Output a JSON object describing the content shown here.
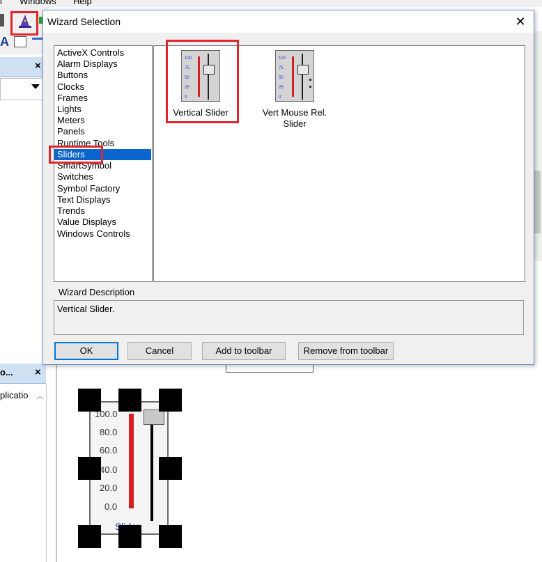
{
  "menubar": {
    "items": [
      "l",
      "Windows",
      "Help"
    ]
  },
  "background_panels": {
    "panel1_close": "×",
    "panel2_title": "o...",
    "panel2_close": "×",
    "panel2_item": "plicatio"
  },
  "wizard": {
    "title": "Wizard Selection",
    "close_glyph": "✕",
    "categories": [
      "ActiveX Controls",
      "Alarm Displays",
      "Buttons",
      "Clocks",
      "Frames",
      "Lights",
      "Meters",
      "Panels",
      "Runtime Tools",
      "Sliders",
      "SmartSymbol",
      "Switches",
      "Symbol Factory",
      "Text Displays",
      "Trends",
      "Value Displays",
      "Windows Controls"
    ],
    "selected_category": "Sliders",
    "items": [
      {
        "label": "Vertical Slider",
        "icon": "vertical-slider-icon"
      },
      {
        "label_line1": "Vert Mouse Rel.",
        "label_line2": "Slider",
        "icon": "vert-mouse-rel-slider-icon"
      }
    ],
    "icon_scale": [
      "100",
      "75",
      "50",
      "25",
      "0"
    ],
    "description_label": "Wizard Description",
    "description_text": "Vertical Slider.",
    "buttons": {
      "ok": "OK",
      "cancel": "Cancel",
      "add_to_toolbar": "Add to toolbar",
      "remove_from_toolbar": "Remove from  toolbar"
    }
  },
  "canvas_slider": {
    "ticks": [
      "100.0",
      "80.0",
      "60.0",
      "40.0",
      "20.0",
      "0.0"
    ],
    "caption": "Slider"
  },
  "colors": {
    "highlight_red": "#e0262b",
    "selection_blue": "#0a66cc",
    "default_button_border": "#0078d7"
  }
}
